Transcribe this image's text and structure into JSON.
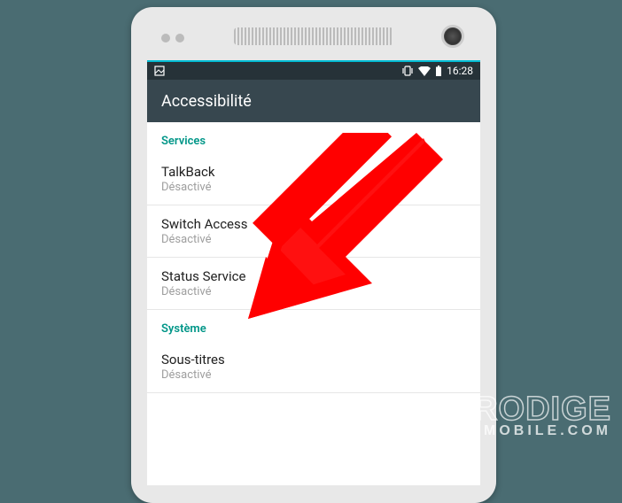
{
  "status_bar": {
    "time": "16:28"
  },
  "app_bar": {
    "title": "Accessibilité"
  },
  "sections": [
    {
      "header": "Services",
      "items": [
        {
          "title": "TalkBack",
          "subtitle": "Désactivé"
        },
        {
          "title": "Switch Access",
          "subtitle": "Désactivé"
        },
        {
          "title": "Status Service",
          "subtitle": "Désactivé"
        }
      ]
    },
    {
      "header": "Système",
      "items": [
        {
          "title": "Sous-titres",
          "subtitle": "Désactivé"
        }
      ]
    }
  ],
  "watermark": {
    "line1": "PRODIGE",
    "line2": "MOBILE.COM"
  }
}
